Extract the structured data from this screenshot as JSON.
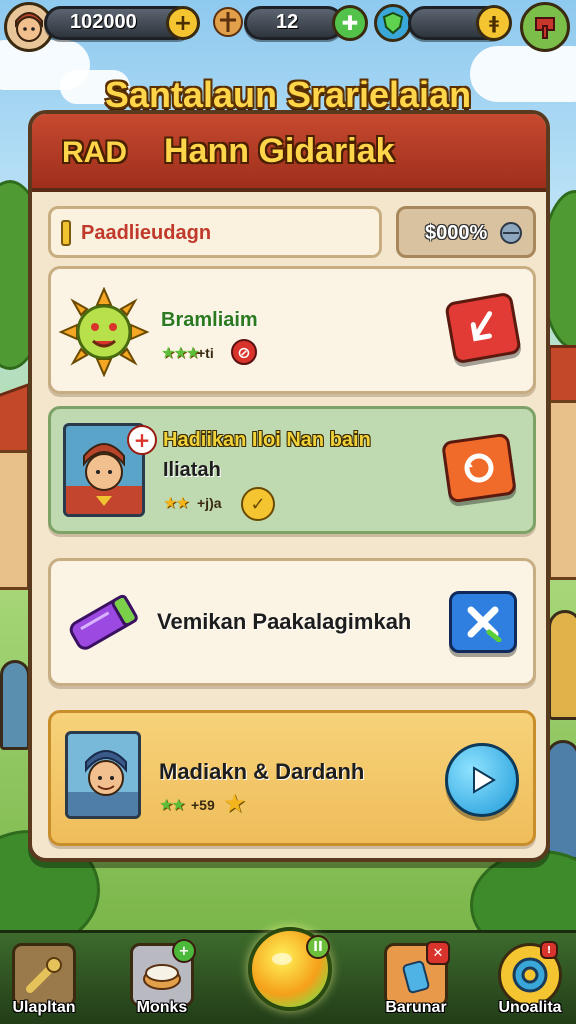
{
  "hud": {
    "coins": "102000",
    "level": "12"
  },
  "title": "Santalaun Srarielaian",
  "panel": {
    "header_left": "RAD",
    "header_title": "Hann Gidariak",
    "search_label": "Paadlieudagn",
    "percent_label": "$000%"
  },
  "rows": [
    {
      "title": "Bramliaim",
      "stat": "+ti",
      "stars": "★★★",
      "style": "plain"
    },
    {
      "title": "Hadiikan Iloi Nan bain",
      "subtitle": "Iliatah",
      "stat": "+j)a",
      "stars": "★★",
      "style": "green"
    },
    {
      "title": "Vemikan Paakalagimkah",
      "style": "plain"
    },
    {
      "title": "Madiakn & Dardanh",
      "stat": "+59",
      "stars": "★★",
      "style": "gold"
    }
  ],
  "nav": [
    {
      "label": "Ulapltan"
    },
    {
      "label": "Monks"
    },
    {
      "label": ""
    },
    {
      "label": "Barunar"
    },
    {
      "label": "Unoalita"
    }
  ],
  "colors": {
    "panel_bg": "#f3e6cc",
    "header_red": "#c7492f",
    "title_yellow": "#ffd64a",
    "nav_green": "#3d6b2c"
  },
  "icons": [
    "avatar",
    "plus-icon",
    "gift-icon",
    "add-icon",
    "shield-icon",
    "coin-icon",
    "flag-icon",
    "sun-icon",
    "down-arrow-icon",
    "undo-icon",
    "close-icon",
    "play-icon",
    "wrench-icon",
    "pie-icon",
    "orb-icon",
    "gear-icon"
  ]
}
